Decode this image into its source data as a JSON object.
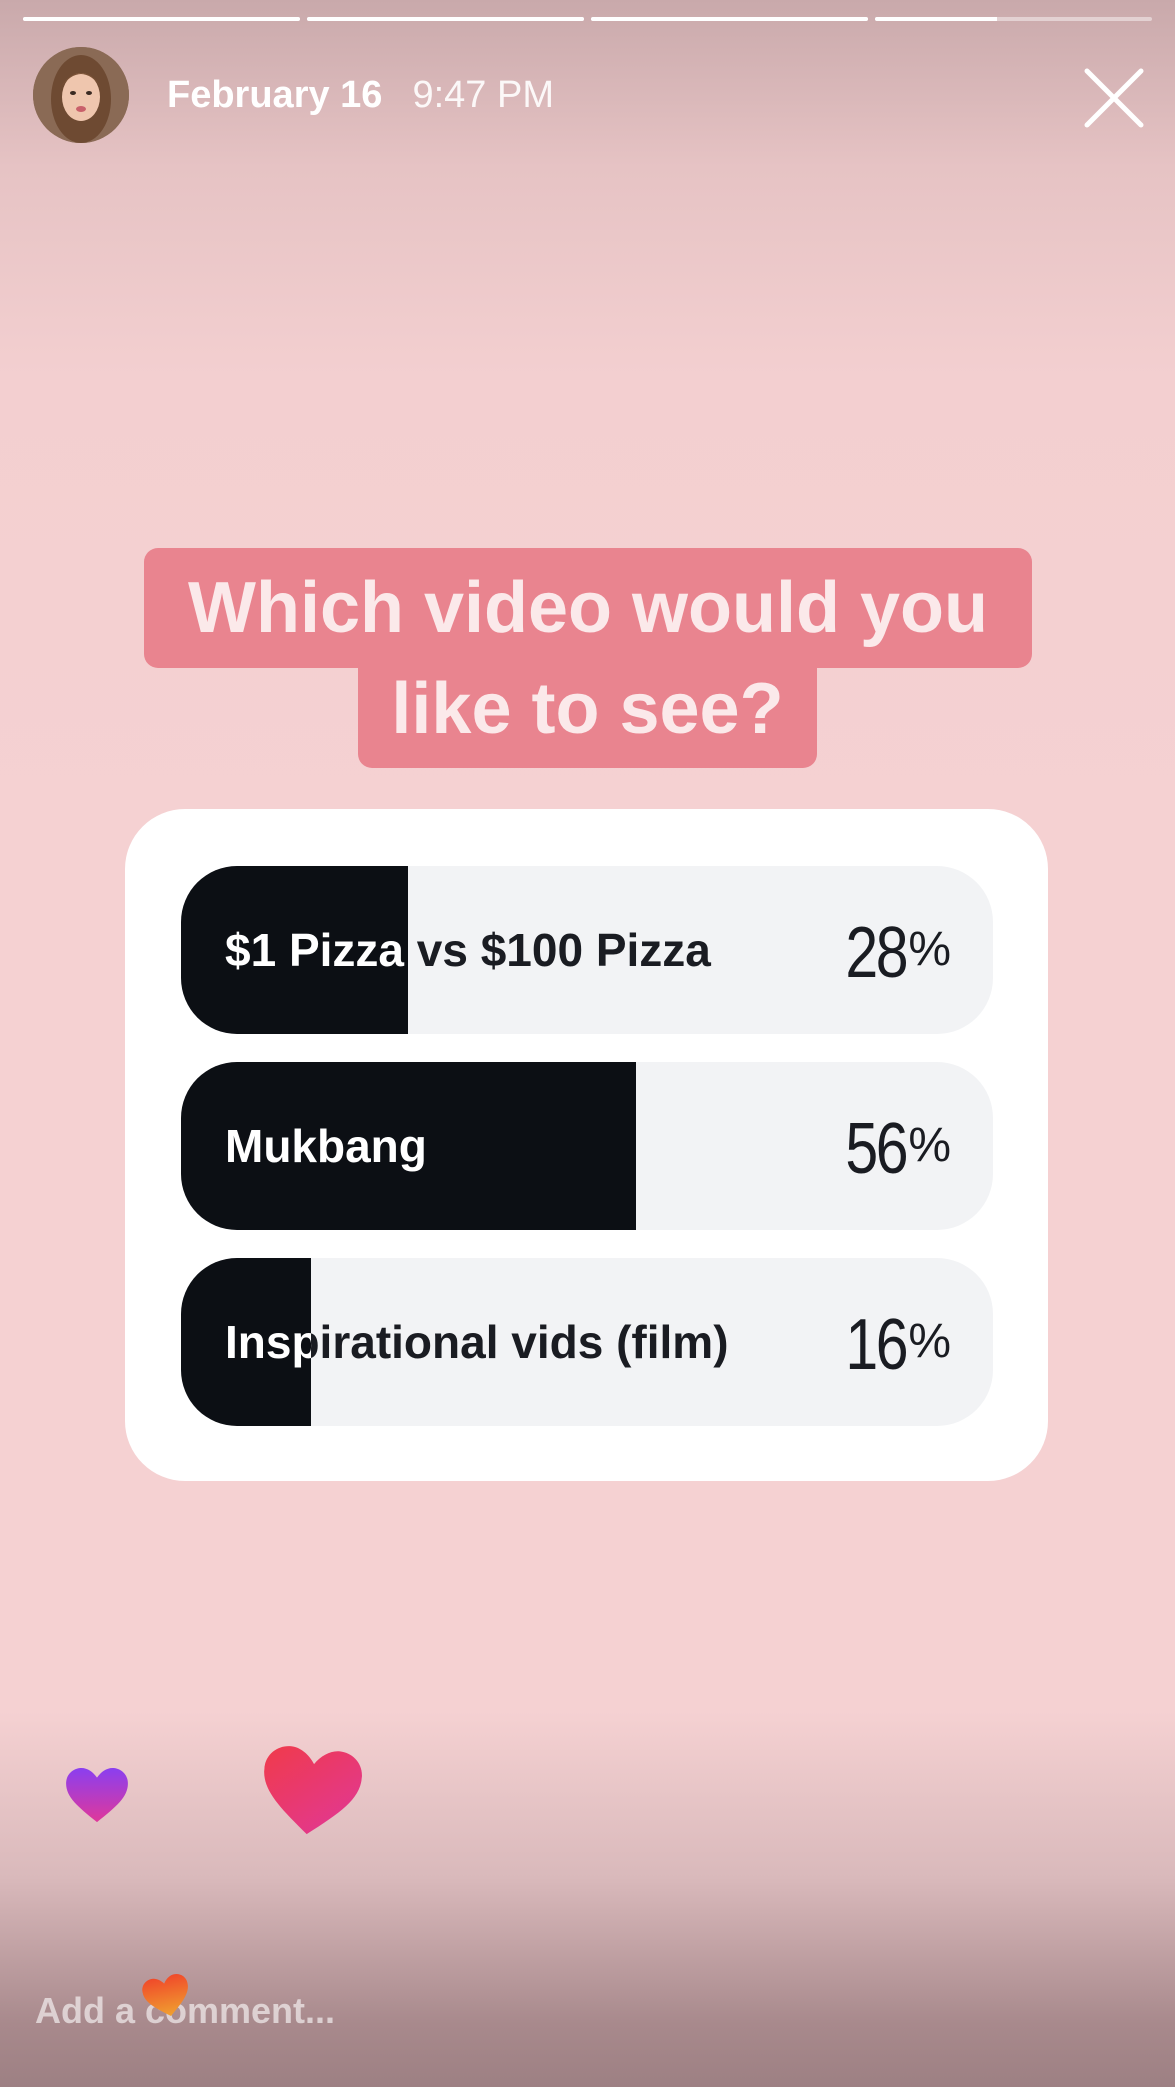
{
  "story": {
    "progress": [
      1,
      1,
      1,
      0.44
    ],
    "date": "February 16",
    "time": "9:47 PM"
  },
  "question": {
    "line1": "Which video would you",
    "line2": "like to see?"
  },
  "poll": {
    "options": [
      {
        "label": "$1 Pizza vs $100 Pizza",
        "percent": "28",
        "fraction": 0.28
      },
      {
        "label": "Mukbang",
        "percent": "56",
        "fraction": 0.56
      },
      {
        "label": "Inspirational vids (film)",
        "percent": "16",
        "fraction": 0.16
      }
    ],
    "percent_sign": "%"
  },
  "comment": {
    "placeholder": "Add a comment..."
  },
  "colors": {
    "question_bg": "#e9848f",
    "bar_fill": "#0c0f14",
    "bar_bg": "#f2f3f5"
  },
  "icons": [
    "close-icon",
    "heart-icon"
  ]
}
